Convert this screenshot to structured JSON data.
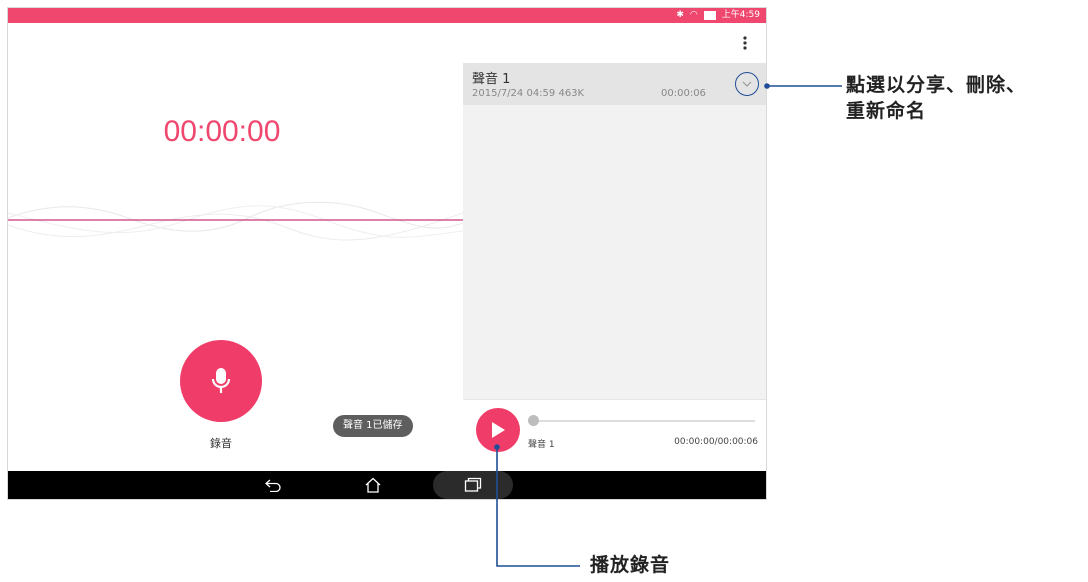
{
  "status_bar": {
    "icons": [
      "bluetooth-icon",
      "wifi-icon",
      "battery-icon"
    ],
    "time": "上午4:59",
    "bg_color": "#f0476e"
  },
  "recorder": {
    "timer": "00:00:00",
    "record_label": "錄音",
    "toast": "聲音 1已儲存",
    "accent_color": "#f0476e"
  },
  "recordings": [
    {
      "title": "聲音 1",
      "meta": "2015/7/24 04:59  463K",
      "duration": "00:00:06"
    }
  ],
  "player": {
    "name": "聲音 1",
    "time": "00:00:00/00:00:06",
    "progress": 0
  },
  "annotations": {
    "chevron_line1": "點選以分享、刪除、",
    "chevron_line2": "重新命名",
    "play": "播放錄音",
    "line_color": "#1f4e96"
  }
}
